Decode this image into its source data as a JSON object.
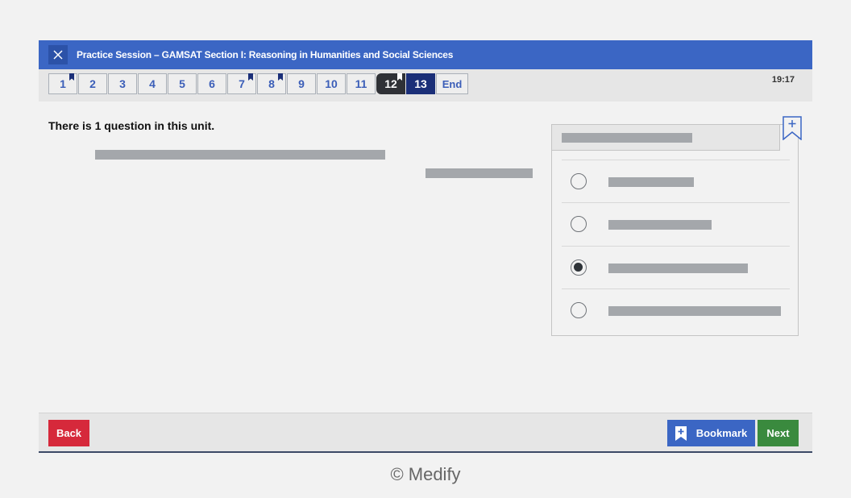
{
  "header": {
    "title": "Practice Session – GAMSAT Section I: Reasoning in Humanities and Social Sciences"
  },
  "navigation": {
    "questions": [
      {
        "label": "1",
        "flagged": true,
        "state": "default"
      },
      {
        "label": "2",
        "flagged": false,
        "state": "default"
      },
      {
        "label": "3",
        "flagged": false,
        "state": "default"
      },
      {
        "label": "4",
        "flagged": false,
        "state": "default"
      },
      {
        "label": "5",
        "flagged": false,
        "state": "default"
      },
      {
        "label": "6",
        "flagged": false,
        "state": "default"
      },
      {
        "label": "7",
        "flagged": true,
        "state": "default"
      },
      {
        "label": "8",
        "flagged": true,
        "state": "default"
      },
      {
        "label": "9",
        "flagged": false,
        "state": "default"
      },
      {
        "label": "10",
        "flagged": false,
        "state": "default"
      },
      {
        "label": "11",
        "flagged": false,
        "state": "default"
      },
      {
        "label": "12",
        "flagged": true,
        "state": "visited"
      },
      {
        "label": "13",
        "flagged": false,
        "state": "current"
      }
    ],
    "end_label": "End",
    "timer": "19:17"
  },
  "main": {
    "instruction": "There is 1 question in this unit.",
    "selected_option": 3
  },
  "footer": {
    "back_label": "Back",
    "bookmark_label": "Bookmark",
    "next_label": "Next"
  },
  "copyright": "© Medify",
  "colors": {
    "header_blue": "#3b66c4",
    "current_question": "#1b2f78",
    "back_red": "#d6293b",
    "next_green": "#3a8a3e",
    "placeholder_gray": "#a4a7ab"
  }
}
